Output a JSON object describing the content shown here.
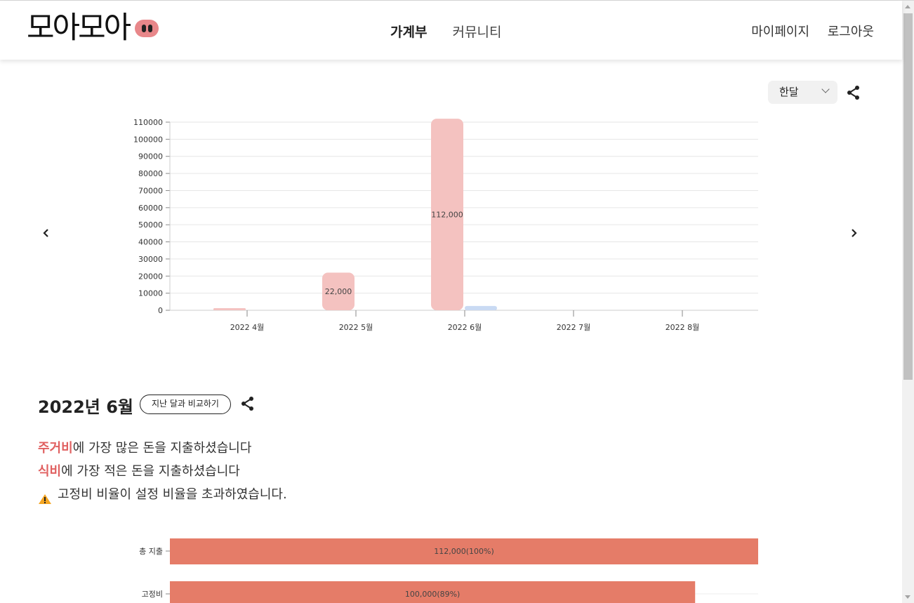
{
  "header": {
    "logo_text": "모아모아",
    "nav": [
      {
        "label": "가계부",
        "active": true
      },
      {
        "label": "커뮤니티",
        "active": false
      }
    ],
    "user_nav": [
      "마이페이지",
      "로그아웃"
    ]
  },
  "controls": {
    "period_value": "한달",
    "icons": [
      "share-icon",
      "chevron-left-icon",
      "chevron-right-icon"
    ]
  },
  "chart_data": [
    {
      "type": "bar",
      "categories": [
        "2022 4월",
        "2022 5월",
        "2022 6월",
        "2022 7월",
        "2022 8월"
      ],
      "series": [
        {
          "color": "#f4c2c0",
          "values": [
            1000,
            22000,
            112000,
            0,
            0
          ]
        },
        {
          "color": "#c9daf3",
          "values": [
            0,
            0,
            2500,
            0,
            0
          ]
        }
      ],
      "data_labels": [
        "",
        "22,000",
        "112,000",
        "",
        ""
      ],
      "yticks": [
        0,
        10000,
        20000,
        30000,
        40000,
        50000,
        60000,
        70000,
        80000,
        90000,
        100000,
        110000
      ],
      "ylim": [
        0,
        110000
      ],
      "grid": true
    },
    {
      "type": "bar",
      "orientation": "horizontal",
      "categories": [
        "총 지출",
        "고정비"
      ],
      "values": [
        112000,
        100000
      ],
      "data_labels": [
        "112,000(100%)",
        "100,000(89%)"
      ],
      "color": "#e57c68",
      "xlim": [
        0,
        112000
      ]
    }
  ],
  "report": {
    "month_title": "2022년 6월",
    "compare_label": "지난 달과 비교하기",
    "lines": [
      {
        "highlight": "주거비",
        "text": "에 가장 많은 돈을 지출하셨습니다"
      },
      {
        "highlight": "식비",
        "text": "에 가장 적은 돈을 지출하셨습니다"
      }
    ],
    "warning": "고정비 비율이 설정 비율을 초과하였습니다."
  }
}
